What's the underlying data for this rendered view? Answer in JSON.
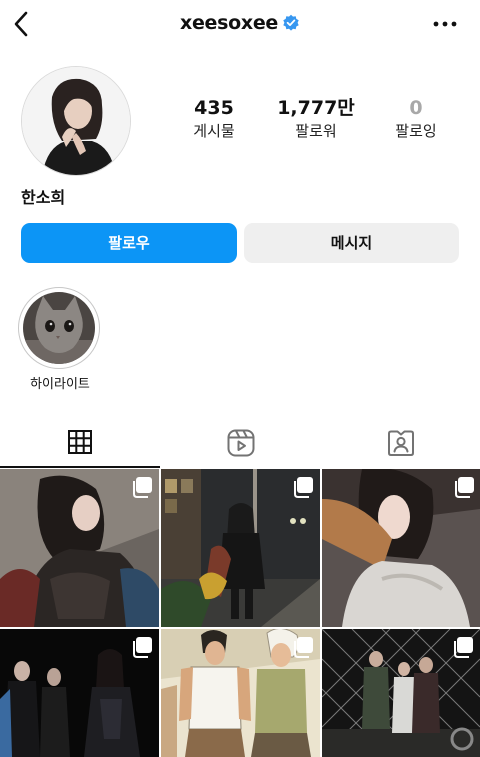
{
  "header": {
    "username": "xeesoxee",
    "verified": true,
    "back_icon": "chevron-left-icon",
    "more_icon": "more-dots-icon"
  },
  "profile": {
    "display_name": "한소희",
    "stats": [
      {
        "value": "435",
        "label": "게시물"
      },
      {
        "value": "1,777만",
        "label": "팔로워"
      },
      {
        "value": "0",
        "label": "팔로잉"
      }
    ]
  },
  "actions": {
    "follow_label": "팔로우",
    "message_label": "메시지"
  },
  "highlights": [
    {
      "label": "하이라이트"
    }
  ],
  "tabs": [
    {
      "name": "posts",
      "icon": "grid-icon",
      "active": true
    },
    {
      "name": "reels",
      "icon": "reels-icon",
      "active": false
    },
    {
      "name": "tagged",
      "icon": "tagged-icon",
      "active": false
    }
  ],
  "posts": [
    {
      "icon": "multi-photo-icon"
    },
    {
      "icon": "multi-photo-icon"
    },
    {
      "icon": "multi-photo-icon"
    },
    {
      "icon": "multi-photo-icon"
    },
    {
      "icon": "multi-photo-icon"
    },
    {
      "icon": "multi-photo-icon"
    }
  ],
  "colors": {
    "follow_button": "#0c95f6",
    "message_button": "#efefef",
    "verified_badge": "#3797f0",
    "muted_text": "#a8a8a8"
  }
}
